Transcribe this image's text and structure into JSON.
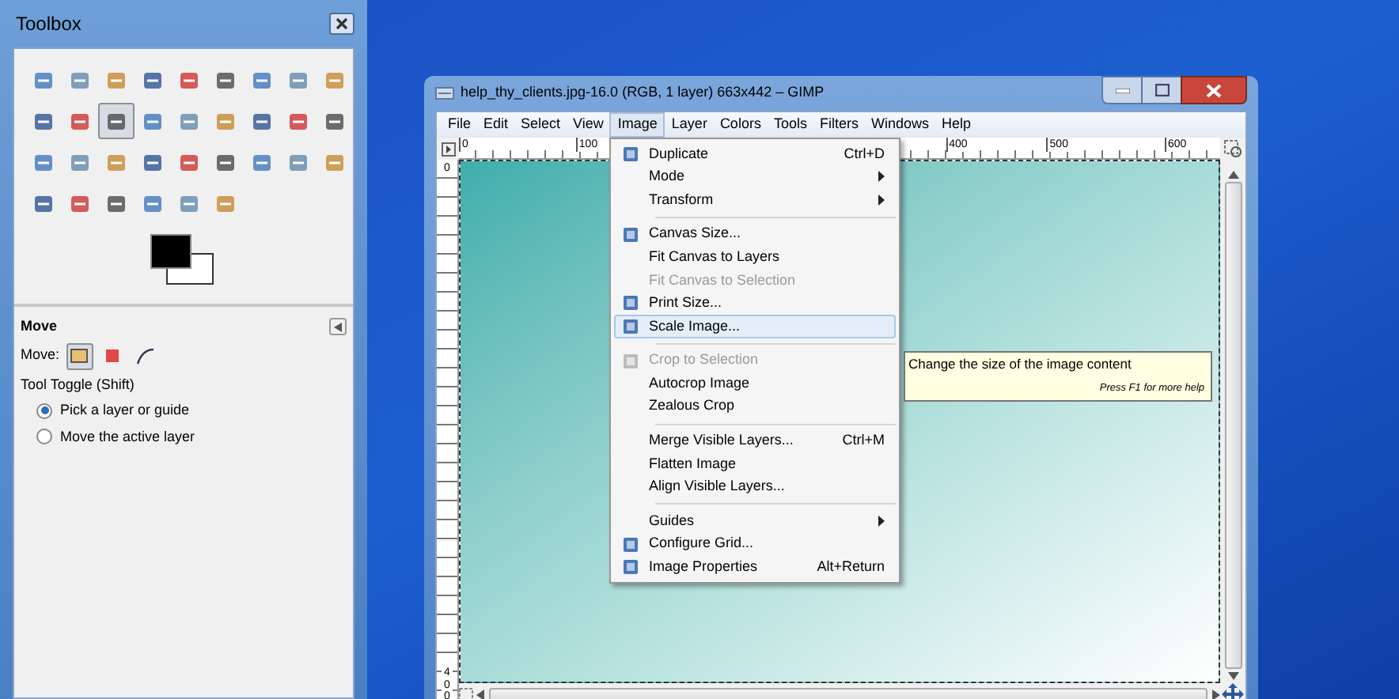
{
  "toolbox": {
    "title": "Toolbox",
    "tools": [
      {
        "selected": false
      },
      {
        "selected": false
      },
      {
        "selected": false
      },
      {
        "selected": false
      },
      {
        "selected": false
      },
      {
        "selected": false
      },
      {
        "selected": false
      },
      {
        "selected": false
      },
      {
        "selected": false
      },
      {
        "selected": false
      },
      {
        "selected": false
      },
      {
        "selected": true
      },
      {
        "selected": false
      },
      {
        "selected": false
      },
      {
        "selected": false
      },
      {
        "selected": false
      },
      {
        "selected": false
      },
      {
        "selected": false
      },
      {
        "selected": false
      },
      {
        "selected": false
      },
      {
        "selected": false
      },
      {
        "selected": false
      },
      {
        "selected": false
      },
      {
        "selected": false
      },
      {
        "selected": false
      },
      {
        "selected": false
      },
      {
        "selected": false
      },
      {
        "selected": false
      },
      {
        "selected": false
      },
      {
        "selected": false
      },
      {
        "selected": false
      },
      {
        "selected": false
      },
      {
        "selected": false
      }
    ],
    "options": {
      "title": "Move",
      "move_label": "Move:",
      "modes": [
        {
          "selected": true
        },
        {
          "selected": false
        },
        {
          "selected": false
        }
      ],
      "toggle_label": "Tool Toggle  (Shift)",
      "radios": [
        {
          "label": "Pick a layer or guide",
          "selected": true
        },
        {
          "label": "Move the active layer",
          "selected": false
        }
      ]
    }
  },
  "window": {
    "title": "help_thy_clients.jpg-16.0 (RGB, 1 layer) 663x442 – GIMP",
    "menus": [
      {
        "label": "File",
        "selected": false
      },
      {
        "label": "Edit",
        "selected": false
      },
      {
        "label": "Select",
        "selected": false
      },
      {
        "label": "View",
        "selected": false
      },
      {
        "label": "Image",
        "selected": true
      },
      {
        "label": "Layer",
        "selected": false
      },
      {
        "label": "Colors",
        "selected": false
      },
      {
        "label": "Tools",
        "selected": false
      },
      {
        "label": "Filters",
        "selected": false
      },
      {
        "label": "Windows",
        "selected": false
      },
      {
        "label": "Help",
        "selected": false
      }
    ],
    "top_ruler": [
      "0",
      "100",
      "400",
      "500",
      "600"
    ],
    "left_ruler": [
      "0",
      "400"
    ]
  },
  "image_menu": [
    {
      "kind": "item",
      "label": "Duplicate",
      "shortcut": "Ctrl+D",
      "icon": true,
      "submenu": false,
      "disabled": false,
      "selected": false
    },
    {
      "kind": "item",
      "label": "Mode",
      "icon": false,
      "submenu": true,
      "disabled": false,
      "selected": false
    },
    {
      "kind": "item",
      "label": "Transform",
      "icon": false,
      "submenu": true,
      "disabled": false,
      "selected": false
    },
    {
      "kind": "separator"
    },
    {
      "kind": "item",
      "label": "Canvas Size...",
      "icon": true,
      "submenu": false,
      "disabled": false,
      "selected": false
    },
    {
      "kind": "item",
      "label": "Fit Canvas to Layers",
      "icon": false,
      "submenu": false,
      "disabled": false,
      "selected": false
    },
    {
      "kind": "item",
      "label": "Fit Canvas to Selection",
      "icon": false,
      "submenu": false,
      "disabled": true,
      "selected": false
    },
    {
      "kind": "item",
      "label": "Print Size...",
      "icon": true,
      "submenu": false,
      "disabled": false,
      "selected": false
    },
    {
      "kind": "item",
      "label": "Scale Image...",
      "icon": true,
      "submenu": false,
      "disabled": false,
      "selected": true
    },
    {
      "kind": "separator"
    },
    {
      "kind": "item",
      "label": "Crop to Selection",
      "icon": true,
      "submenu": false,
      "disabled": true,
      "selected": false
    },
    {
      "kind": "item",
      "label": "Autocrop Image",
      "icon": false,
      "submenu": false,
      "disabled": false,
      "selected": false
    },
    {
      "kind": "item",
      "label": "Zealous Crop",
      "icon": false,
      "submenu": false,
      "disabled": false,
      "selected": false
    },
    {
      "kind": "separator"
    },
    {
      "kind": "item",
      "label": "Merge Visible Layers...",
      "shortcut": "Ctrl+M",
      "icon": false,
      "submenu": false,
      "disabled": false,
      "selected": false
    },
    {
      "kind": "item",
      "label": "Flatten Image",
      "icon": false,
      "submenu": false,
      "disabled": false,
      "selected": false
    },
    {
      "kind": "item",
      "label": "Align Visible Layers...",
      "icon": false,
      "submenu": false,
      "disabled": false,
      "selected": false
    },
    {
      "kind": "separator"
    },
    {
      "kind": "item",
      "label": "Guides",
      "icon": false,
      "submenu": true,
      "disabled": false,
      "selected": false
    },
    {
      "kind": "item",
      "label": "Configure Grid...",
      "icon": true,
      "submenu": false,
      "disabled": false,
      "selected": false
    },
    {
      "kind": "item",
      "label": "Image Properties",
      "shortcut": "Alt+Return",
      "icon": true,
      "submenu": false,
      "disabled": false,
      "selected": false
    }
  ],
  "tooltip": {
    "text": "Change the size of the image content",
    "hint": "Press F1 for more help"
  }
}
